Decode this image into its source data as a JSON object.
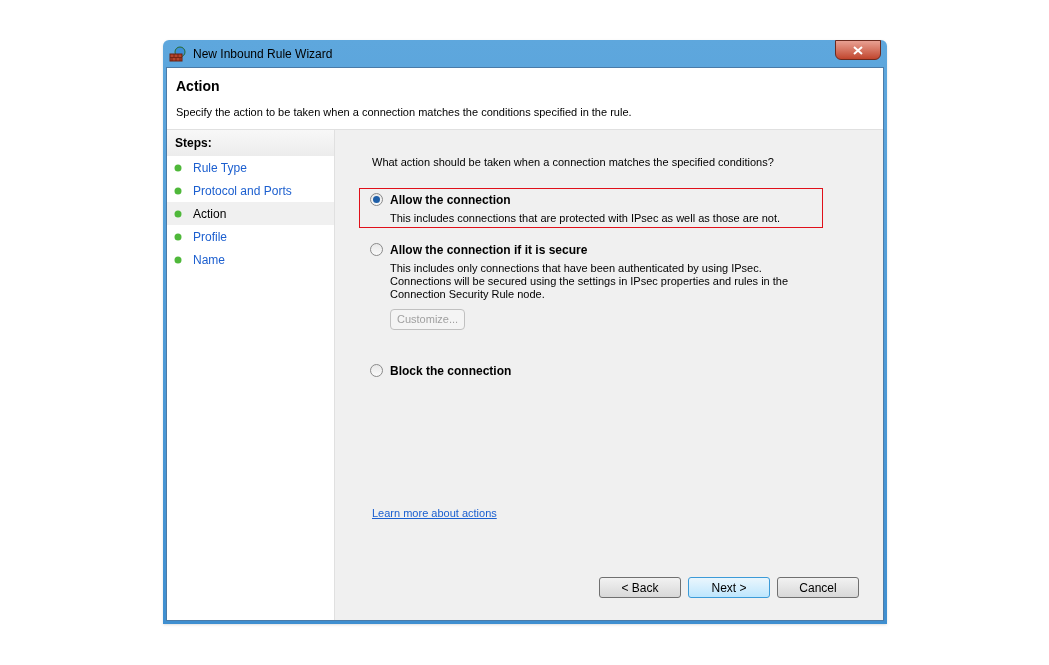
{
  "window": {
    "title": "New Inbound Rule Wizard"
  },
  "header": {
    "title": "Action",
    "description": "Specify the action to be taken when a connection matches the conditions specified in the rule."
  },
  "steps": {
    "title": "Steps:",
    "items": [
      {
        "label": "Rule Type",
        "selected": false
      },
      {
        "label": "Protocol and Ports",
        "selected": false
      },
      {
        "label": "Action",
        "selected": true
      },
      {
        "label": "Profile",
        "selected": false
      },
      {
        "label": "Name",
        "selected": false
      }
    ]
  },
  "question": "What action should be taken when a connection matches the specified conditions?",
  "options": [
    {
      "label": "Allow the connection",
      "description": "This includes connections that are protected with IPsec as well as those are not.",
      "selected": true,
      "highlighted": true
    },
    {
      "label": "Allow the connection if it is secure",
      "description": "This includes only connections that have been authenticated by using IPsec.  Connections will be secured using the settings in IPsec properties and rules in the Connection Security Rule node.",
      "button": {
        "label": "Customize...",
        "disabled": true
      },
      "selected": false,
      "highlighted": false
    },
    {
      "label": "Block the connection",
      "selected": false,
      "highlighted": false
    }
  ],
  "link": "Learn more about actions",
  "buttons": [
    {
      "label": "< Back",
      "default": false
    },
    {
      "label": "Next >",
      "default": true
    },
    {
      "label": "Cancel",
      "default": false
    }
  ]
}
